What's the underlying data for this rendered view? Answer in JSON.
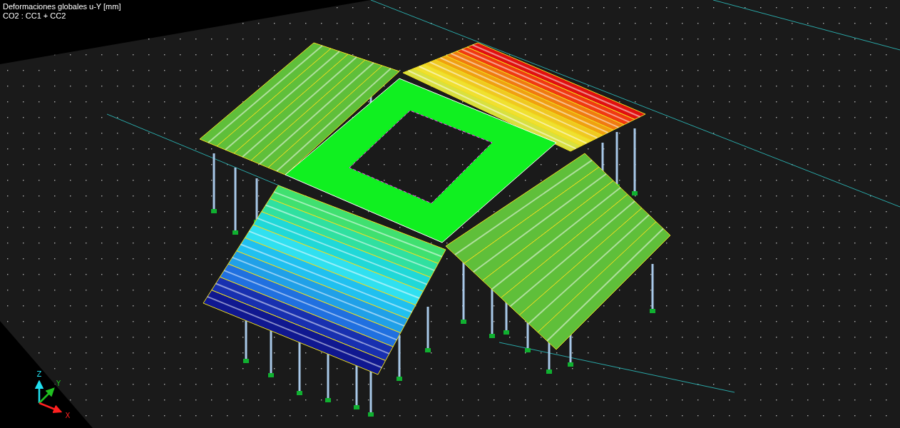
{
  "viewport": {
    "title": "Deformaciones globales u-Y [mm]",
    "load_combination": "CO2 : CC1 + CC2",
    "axes": [
      {
        "label": "Z",
        "kind": "z"
      },
      {
        "label": "Y",
        "kind": "y"
      },
      {
        "label": "X",
        "kind": "x"
      }
    ]
  }
}
